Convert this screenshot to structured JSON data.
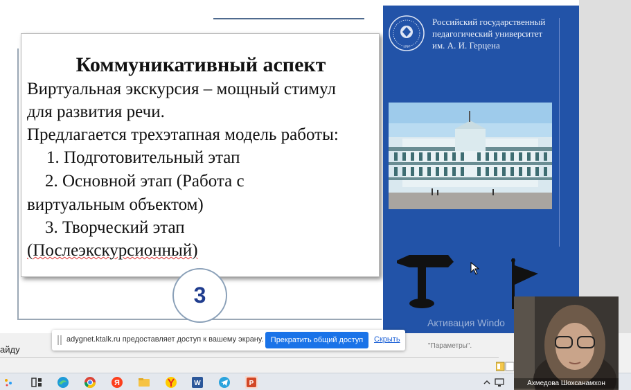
{
  "slide": {
    "title": "Коммуникативный аспект",
    "lines": [
      "Виртуальная экскурсия – мощный стимул",
      "для развития речи.",
      "Предлагается трехэтапная модель работы:",
      "   1. Подготовительный этап",
      "   2. Основной этап (Работа с",
      "виртуальным объектом)",
      "   3. Творческий этап",
      "(Послеэкскурсионный)"
    ],
    "slide_number": "3"
  },
  "panel": {
    "university_name": [
      "Российский государственный",
      "педагогический университет",
      "им. А. И. Герцена"
    ],
    "logo_year": "1797"
  },
  "overlay": {
    "activation_text": "Активация Windo",
    "settings_hint": "\"Параметры\".",
    "left_fragment": "айду"
  },
  "share_bar": {
    "message": "adygnet.ktalk.ru предоставляет доступ к вашему экрану.",
    "stop_button": "Прекратить общий доступ",
    "hide_link": "Скрыть"
  },
  "video": {
    "participant_name": "Ахмедова Шохсанамхон"
  },
  "taskbar": {
    "icons": [
      "widgets-icon",
      "task-view-icon",
      "edge-icon",
      "chrome-icon",
      "yandex-icon",
      "explorer-icon",
      "yandex-browser-icon",
      "word-icon",
      "telegram-icon",
      "powerpoint-icon"
    ]
  },
  "colors": {
    "panel_blue": "#2253a8",
    "share_button": "#1a73e8",
    "slide_number": "#1f3c8e"
  }
}
